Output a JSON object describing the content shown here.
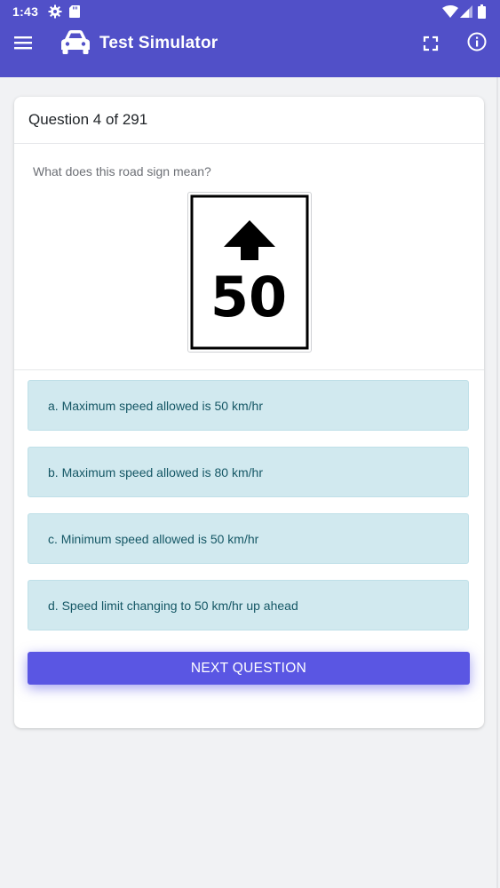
{
  "status_bar": {
    "time": "1:43",
    "icons": [
      "gear-icon",
      "sd-card-icon",
      "wifi-icon",
      "signal-icon",
      "battery-icon"
    ]
  },
  "app_bar": {
    "title": "Test Simulator",
    "icons": [
      "menu-icon",
      "car-icon",
      "fullscreen-icon",
      "info-icon"
    ],
    "color": "#5150c8"
  },
  "question": {
    "counter": "Question 4 of 291",
    "text": "What does this road sign mean?",
    "sign": {
      "number": "50",
      "symbol": "up-arrow"
    }
  },
  "options": [
    {
      "label": "a. Maximum speed allowed is 50 km/hr"
    },
    {
      "label": "b. Maximum speed allowed is 80 km/hr"
    },
    {
      "label": "c. Minimum speed allowed is 50 km/hr"
    },
    {
      "label": "d. Speed limit changing to 50 km/hr up ahead"
    }
  ],
  "next_button": {
    "label": "NEXT QUESTION",
    "color": "#5a56e3"
  },
  "colors": {
    "option_bg": "#d1e9ef",
    "option_text": "#155765",
    "page_bg": "#f1f2f4"
  }
}
